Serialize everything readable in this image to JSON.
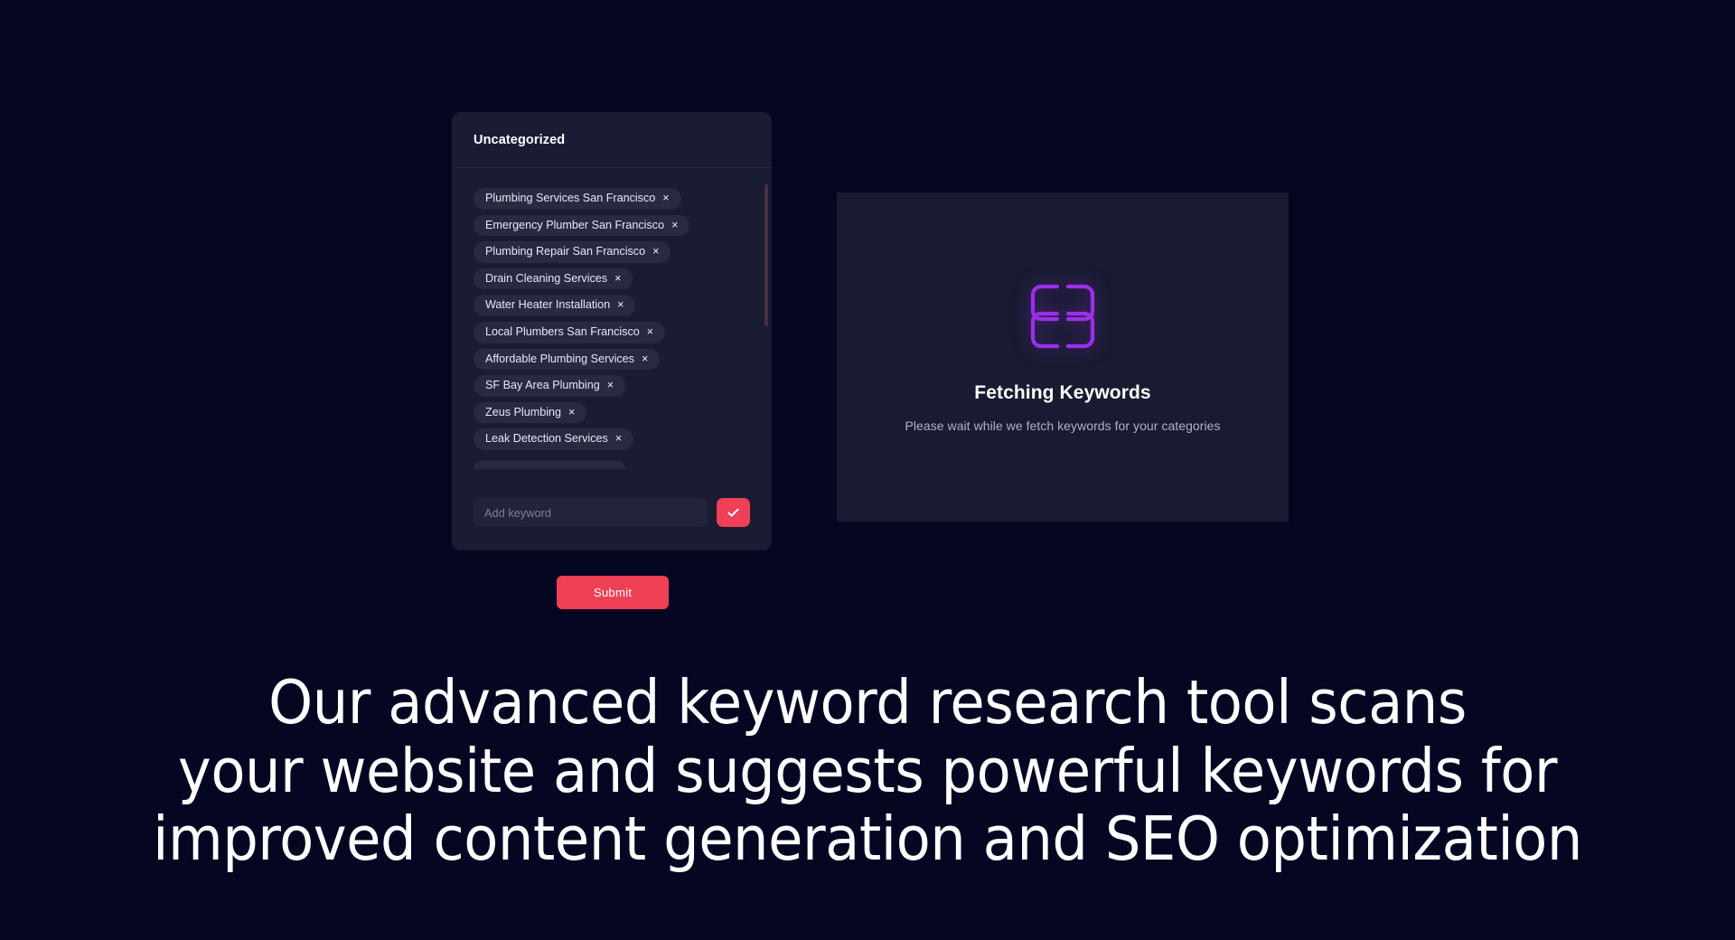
{
  "page": {
    "background_color": "#040622",
    "accent_color": "#ef4056",
    "loader_color": "#9b2fe8"
  },
  "keyword_card": {
    "title": "Uncategorized",
    "chips": [
      {
        "label": "Plumbing Services San Francisco",
        "remove": "×"
      },
      {
        "label": "Emergency Plumber San Francisco",
        "remove": "×"
      },
      {
        "label": "Plumbing Repair San Francisco",
        "remove": "×"
      },
      {
        "label": "Drain Cleaning Services",
        "remove": "×"
      },
      {
        "label": "Water Heater Installation",
        "remove": "×"
      },
      {
        "label": "Local Plumbers San Francisco",
        "remove": "×"
      },
      {
        "label": "Affordable Plumbing Services",
        "remove": "×"
      },
      {
        "label": "SF Bay Area Plumbing",
        "remove": "×"
      },
      {
        "label": "Zeus Plumbing",
        "remove": "×"
      },
      {
        "label": "Leak Detection Services",
        "remove": "×"
      }
    ],
    "add_input": {
      "value": "",
      "placeholder": "Add keyword"
    },
    "confirm_icon": "check-icon"
  },
  "submit": {
    "label": "Submit"
  },
  "fetch_panel": {
    "icon": "four-squares-loader-icon",
    "title": "Fetching Keywords",
    "subtitle": "Please wait while we fetch keywords for your categories"
  },
  "headline": {
    "line1": "Our advanced keyword research tool scans",
    "line2": "your website and suggests powerful keywords for",
    "line3": "improved content generation and SEO optimization"
  }
}
